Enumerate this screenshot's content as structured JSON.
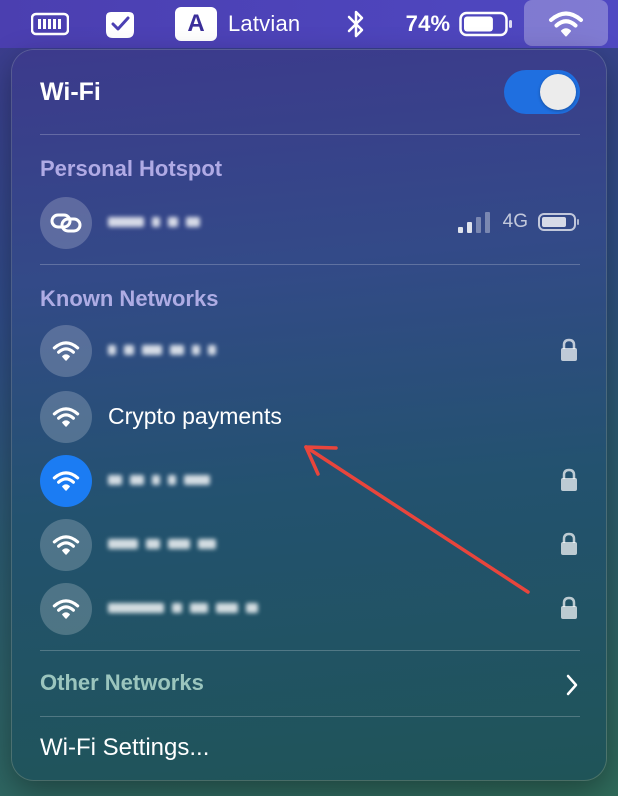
{
  "menubar": {
    "input_source_letter": "A",
    "input_source_name": "Latvian",
    "battery_percent": "74%",
    "battery_level": 0.74,
    "icons": [
      "app-grid-icon",
      "checkmark-badge-icon",
      "bluetooth-icon",
      "battery-icon",
      "wifi-icon"
    ]
  },
  "panel": {
    "title": "Wi-Fi",
    "wifi_enabled": true,
    "personal_hotspot": {
      "heading": "Personal Hotspot",
      "network_type": "4G",
      "signal_bars_filled": 2,
      "signal_bars_total": 4
    },
    "known_networks": {
      "heading": "Known Networks",
      "items": [
        {
          "name": "",
          "locked": true,
          "connected": false
        },
        {
          "name": "Crypto payments",
          "locked": false,
          "connected": false
        },
        {
          "name": "",
          "locked": true,
          "connected": true
        },
        {
          "name": "",
          "locked": true,
          "connected": false
        },
        {
          "name": "",
          "locked": true,
          "connected": false
        }
      ]
    },
    "other_networks": "Other Networks",
    "settings_link": "Wi-Fi Settings..."
  },
  "colors": {
    "accent_blue": "#1b7cf3",
    "annotation_arrow": "#e8453c"
  }
}
